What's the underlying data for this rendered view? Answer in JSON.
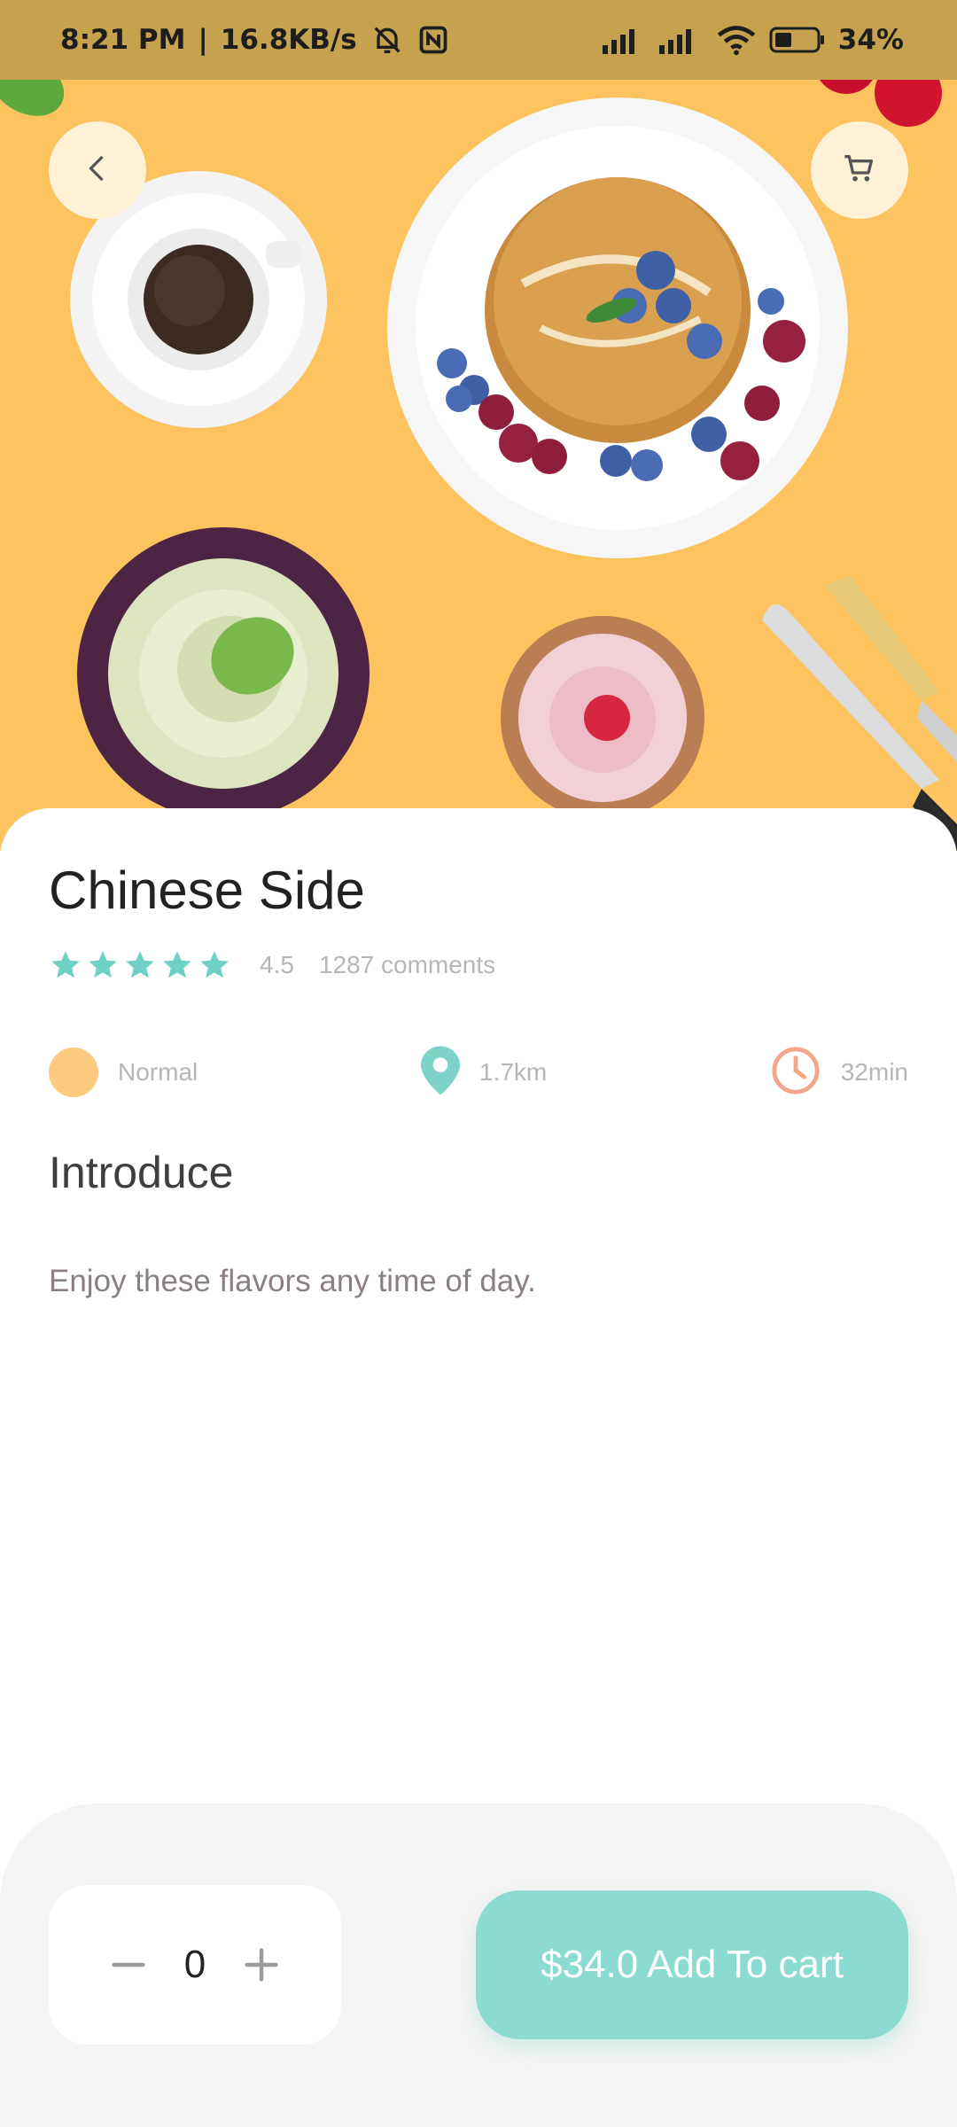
{
  "status_bar": {
    "time": "8:21 PM",
    "separator": "|",
    "network_speed": "16.8KB/s",
    "battery": "34%"
  },
  "header": {
    "back_icon": "chevron-left-icon",
    "cart_icon": "shopping-cart-icon"
  },
  "product": {
    "name": "Chinese Side",
    "rating": 5,
    "rating_value": "4.5",
    "comments": "1287 comments",
    "info": {
      "level": "Normal",
      "distance": "1.7km",
      "time": "32min"
    },
    "section_title": "Introduce",
    "description": "Enjoy these flavors any time of day."
  },
  "cart_bar": {
    "quantity": "0",
    "add_label": "$34.0 Add To cart"
  },
  "colors": {
    "hero_background": "#FCC35F",
    "accent_teal": "#8CDBD0",
    "star_teal": "#6FD0C4",
    "level_orange": "#FDCB7F",
    "clock_salmon": "#F2A788"
  }
}
